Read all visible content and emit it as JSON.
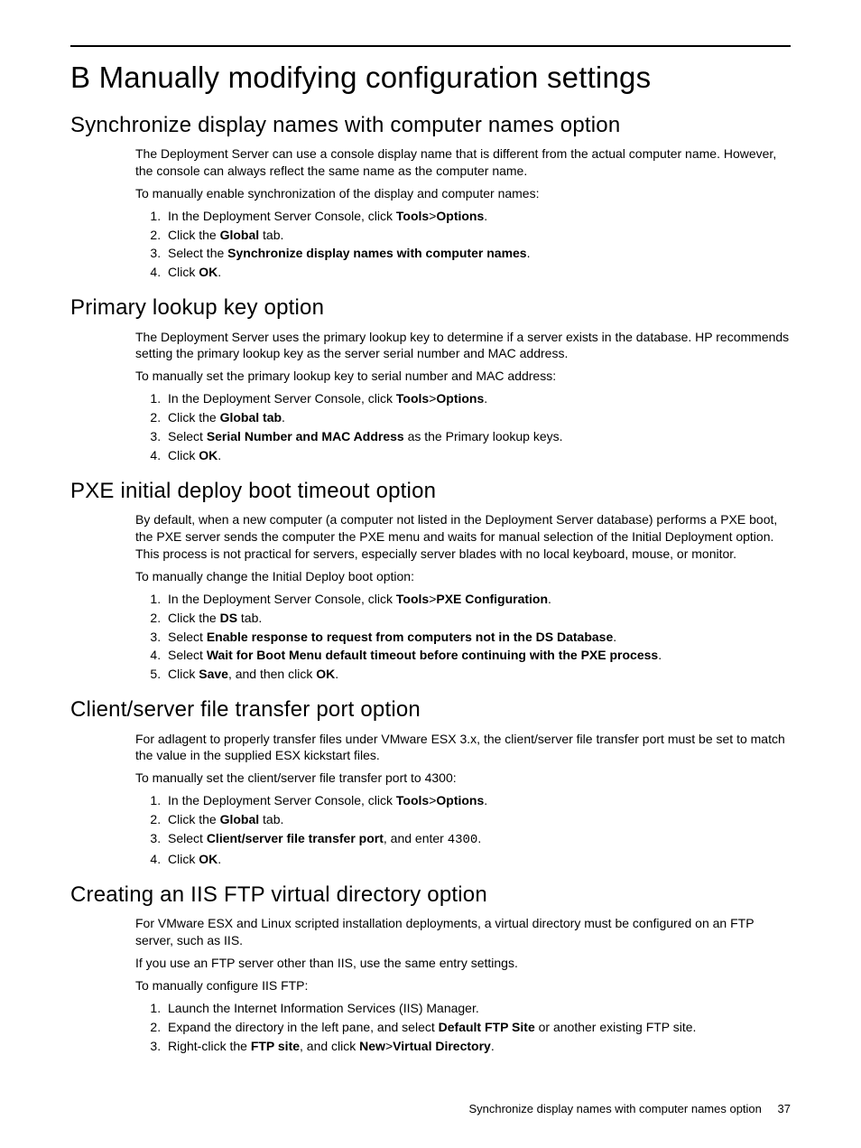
{
  "title": "B Manually modifying configuration settings",
  "footer": {
    "text": "Synchronize display names with computer names option",
    "page": "37"
  },
  "sections": {
    "sync": {
      "heading": "Synchronize display names with computer names option",
      "p1": "The Deployment Server can use a console display name that is different from the actual computer name. However, the console can always reflect the same name as the computer name.",
      "p2": "To manually enable synchronization of the display and computer names:",
      "li1a": "In the Deployment Server Console, click ",
      "li1b": "Tools",
      "li1c": ">",
      "li1d": "Options",
      "li1e": ".",
      "li2a": "Click the ",
      "li2b": "Global",
      "li2c": " tab.",
      "li3a": "Select the ",
      "li3b": "Synchronize display names with computer names",
      "li3c": ".",
      "li4a": "Click ",
      "li4b": "OK",
      "li4c": "."
    },
    "primary": {
      "heading": "Primary lookup key option",
      "p1": "The Deployment Server uses the primary lookup key to determine if a server exists in the database. HP recommends setting the primary lookup key as the server serial number and MAC address.",
      "p2": "To manually set the primary lookup key to serial number and MAC address:",
      "li1a": "In the Deployment Server Console, click ",
      "li1b": "Tools",
      "li1c": ">",
      "li1d": "Options",
      "li1e": ".",
      "li2a": "Click the ",
      "li2b": "Global tab",
      "li2c": ".",
      "li3a": "Select ",
      "li3b": "Serial Number and MAC Address",
      "li3c": " as the Primary lookup keys.",
      "li4a": "Click ",
      "li4b": "OK",
      "li4c": "."
    },
    "pxe": {
      "heading": "PXE initial deploy boot timeout option",
      "p1": "By default, when a new computer (a computer not listed in the Deployment Server database) performs a PXE boot, the PXE server sends the computer the PXE menu and waits for manual selection of the Initial Deployment option. This process is not practical for servers, especially server blades with no local keyboard, mouse, or monitor.",
      "p2": "To manually change the Initial Deploy boot option:",
      "li1a": "In the Deployment Server Console, click ",
      "li1b": "Tools",
      "li1c": ">",
      "li1d": "PXE Configuration",
      "li1e": ".",
      "li2a": "Click the ",
      "li2b": "DS",
      "li2c": " tab.",
      "li3a": "Select ",
      "li3b": "Enable response to request from computers not in the DS Database",
      "li3c": ".",
      "li4a": "Select ",
      "li4b": "Wait for Boot Menu default timeout before continuing with the PXE process",
      "li4c": ".",
      "li5a": "Click ",
      "li5b": "Save",
      "li5c": ", and then click ",
      "li5d": "OK",
      "li5e": "."
    },
    "port": {
      "heading": "Client/server file transfer port option",
      "p1": "For adlagent to properly transfer files under VMware ESX 3.x, the client/server file transfer port must be set to match the value in the supplied ESX kickstart files.",
      "p2": "To manually set the client/server file transfer port to 4300:",
      "li1a": "In the Deployment Server Console, click ",
      "li1b": "Tools",
      "li1c": ">",
      "li1d": "Options",
      "li1e": ".",
      "li2a": "Click the ",
      "li2b": "Global",
      "li2c": " tab.",
      "li3a": "Select ",
      "li3b": "Client/server file transfer port",
      "li3c": ", and enter ",
      "li3d": "4300",
      "li3e": ".",
      "li4a": "Click ",
      "li4b": "OK",
      "li4c": "."
    },
    "iis": {
      "heading": "Creating an IIS FTP virtual directory option",
      "p1": "For VMware ESX and Linux scripted installation deployments, a virtual directory must be configured on an FTP server, such as IIS.",
      "p2": "If you use an FTP server other than IIS, use the same entry settings.",
      "p3": "To manually configure IIS FTP:",
      "li1": "Launch the Internet Information Services (IIS) Manager.",
      "li2a": "Expand the directory in the left pane, and select ",
      "li2b": "Default FTP Site",
      "li2c": " or another existing FTP site.",
      "li3a": "Right-click the ",
      "li3b": "FTP site",
      "li3c": ", and click ",
      "li3d": "New",
      "li3e": ">",
      "li3f": "Virtual Directory",
      "li3g": "."
    }
  }
}
